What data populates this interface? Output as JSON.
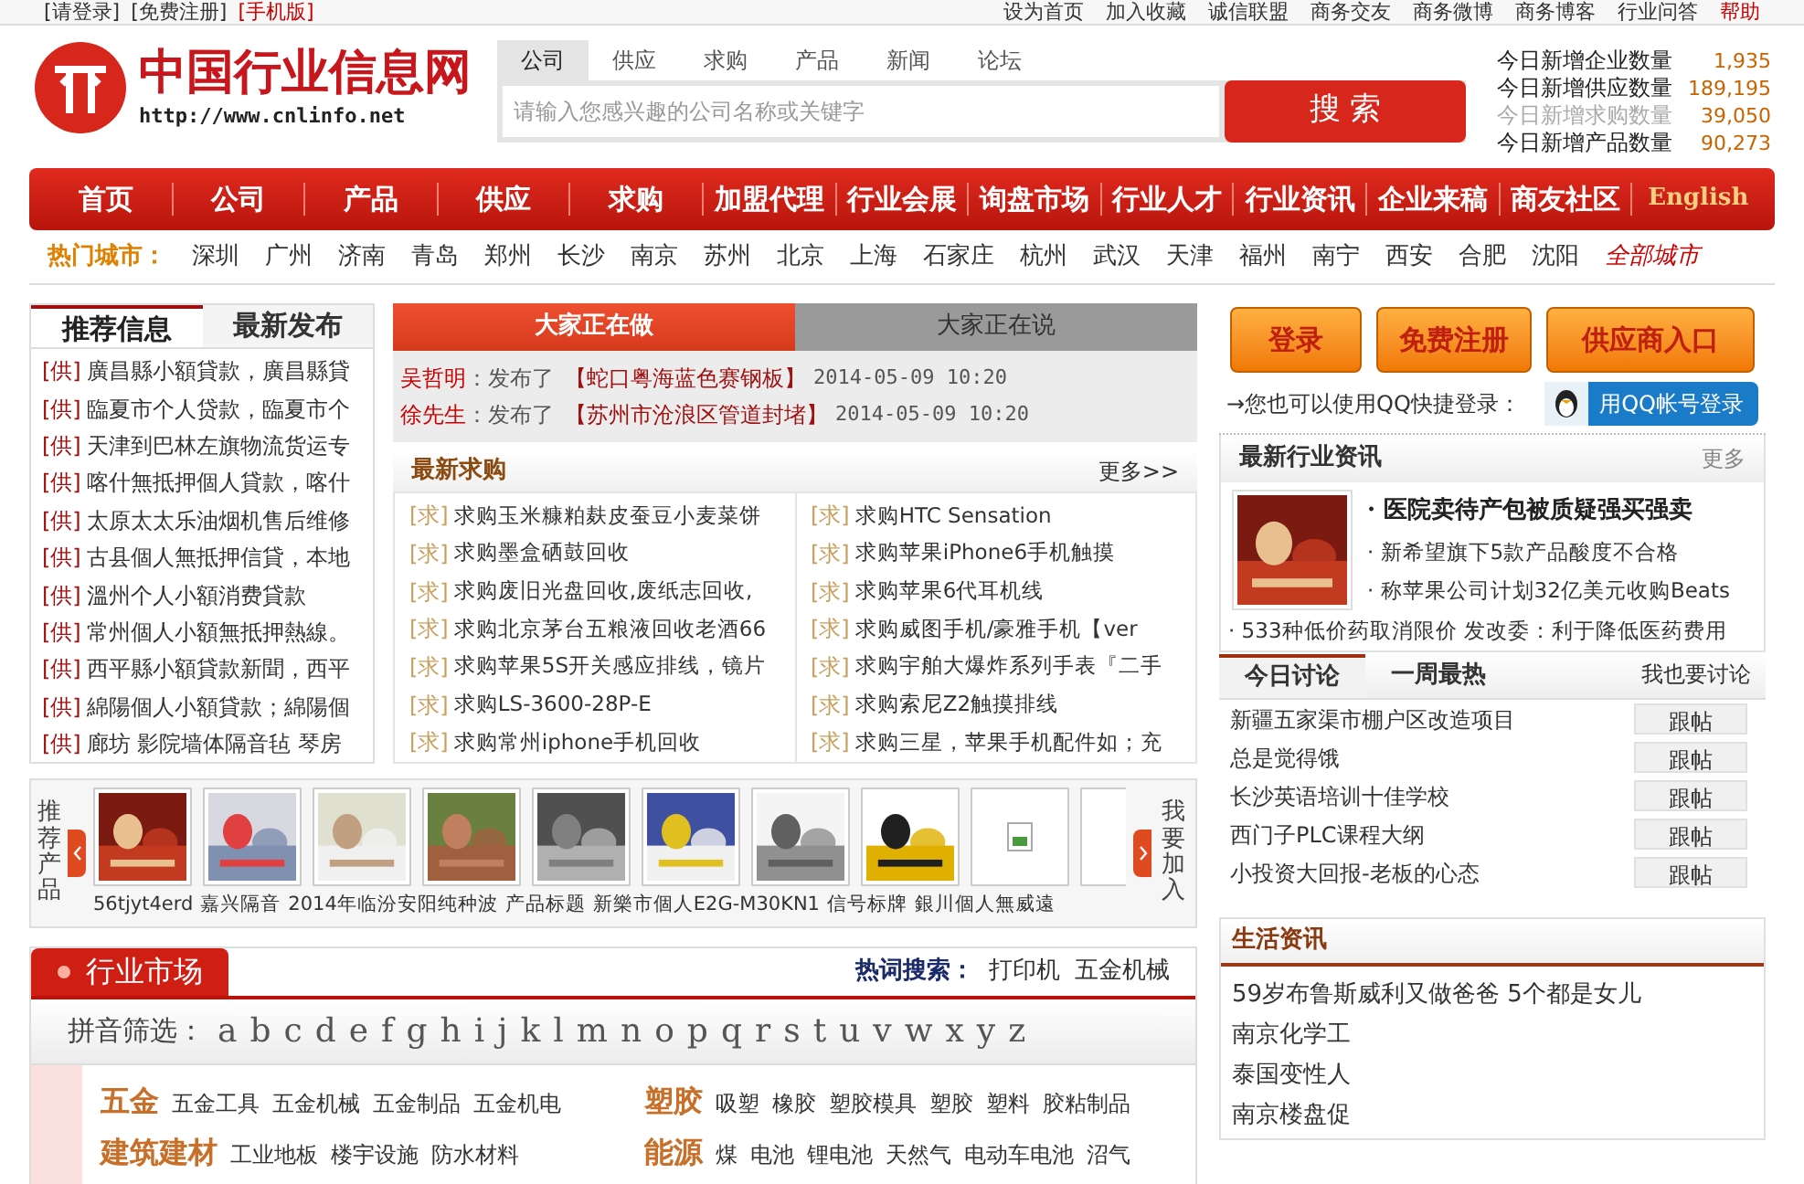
{
  "top_bar": {
    "left_links": [
      "[请登录]",
      "[免费注册]"
    ],
    "mobile_link": "[手机版]",
    "right_links": [
      {
        "text": "设为首页",
        "highlight": false
      },
      {
        "text": "加入收藏",
        "highlight": false
      },
      {
        "text": "诚信联盟",
        "highlight": false
      },
      {
        "text": "商务交友",
        "highlight": false
      },
      {
        "text": "商务微博",
        "highlight": false
      },
      {
        "text": "商务博客",
        "highlight": false
      },
      {
        "text": "行业问答",
        "highlight": false
      },
      {
        "text": "帮助",
        "highlight": true
      }
    ]
  },
  "header": {
    "logo": {
      "name": "中国行业信息网",
      "url": "http://www.cnlinfo.net"
    },
    "search": {
      "tabs": [
        {
          "label": "公司",
          "selected": true
        },
        {
          "label": "供应",
          "selected": false
        },
        {
          "label": "求购",
          "selected": false
        },
        {
          "label": "产品",
          "selected": false
        },
        {
          "label": "新闻",
          "selected": false
        },
        {
          "label": "论坛",
          "selected": false
        }
      ],
      "placeholder": "请输入您感兴趣的公司名称或关键字",
      "button": "搜 索"
    },
    "stats": [
      {
        "label": "今日新增企业数量",
        "value": "1,935",
        "dimmed": false
      },
      {
        "label": "今日新增供应数量",
        "value": "189,195",
        "dimmed": false
      },
      {
        "label": "今日新增求购数量",
        "value": "39,050",
        "dimmed": true
      },
      {
        "label": "今日新增产品数量",
        "value": "90,273",
        "dimmed": false
      }
    ]
  },
  "nav": [
    {
      "label": "首页",
      "kind": "cn"
    },
    {
      "label": "公司",
      "kind": "cn"
    },
    {
      "label": "产品",
      "kind": "cn"
    },
    {
      "label": "供应",
      "kind": "cn"
    },
    {
      "label": "求购",
      "kind": "cn"
    },
    {
      "label": "加盟代理",
      "kind": "cn"
    },
    {
      "label": "行业会展",
      "kind": "cn"
    },
    {
      "label": "询盘市场",
      "kind": "cn"
    },
    {
      "label": "行业人才",
      "kind": "cn"
    },
    {
      "label": "行业资讯",
      "kind": "cn"
    },
    {
      "label": "企业来稿",
      "kind": "cn"
    },
    {
      "label": "商友社区",
      "kind": "cn"
    },
    {
      "label": "English",
      "kind": "en"
    }
  ],
  "hot_cities": {
    "label": "热门城市：",
    "cities": [
      "深圳",
      "广州",
      "济南",
      "青岛",
      "郑州",
      "长沙",
      "南京",
      "苏州",
      "北京",
      "上海",
      "石家庄",
      "杭州",
      "武汉",
      "天津",
      "福州",
      "南宁",
      "西安",
      "合肥",
      "沈阳"
    ],
    "all": "全部城市"
  },
  "recommend": {
    "tabs": [
      {
        "label": "推荐信息",
        "selected": true
      },
      {
        "label": "最新发布",
        "selected": false
      }
    ],
    "items": [
      {
        "tag": "[供]",
        "text": "廣昌縣小額貸款，廣昌縣貸"
      },
      {
        "tag": "[供]",
        "text": "臨夏市个人贷款，臨夏市个"
      },
      {
        "tag": "[供]",
        "text": "天津到巴林左旗物流货运专"
      },
      {
        "tag": "[供]",
        "text": "喀什無抵押個人貸款，喀什"
      },
      {
        "tag": "[供]",
        "text": "太原太太乐油烟机售后维修"
      },
      {
        "tag": "[供]",
        "text": "古县個人無抵押信貸，本地"
      },
      {
        "tag": "[供]",
        "text": "溫州个人小額消费貸款"
      },
      {
        "tag": "[供]",
        "text": "常州個人小額無抵押熱線。"
      },
      {
        "tag": "[供]",
        "text": "西平縣小額貸款新聞，西平"
      },
      {
        "tag": "[供]",
        "text": "綿陽個人小額貸款；綿陽個"
      },
      {
        "tag": "[供]",
        "text": "廊坊 影院墙体隔音毡 琴房"
      }
    ]
  },
  "activity": {
    "tabs": [
      {
        "label": "大家正在做",
        "selected": true
      },
      {
        "label": "大家正在说",
        "selected": false
      }
    ],
    "entries": [
      {
        "user": "吴哲明",
        "action": "：发布了",
        "title": "【蛇口粤海蓝色赛钢板】",
        "time": "2014-05-09 10:20"
      },
      {
        "user": "徐先生",
        "action": "：发布了",
        "title": "【苏州市沧浪区管道封堵】",
        "time": "2014-05-09 10:20"
      }
    ]
  },
  "latest_buy": {
    "title": "最新求购",
    "more": "更多>>",
    "left": [
      {
        "tag": "[求]",
        "text": "求购玉米糠粕麸皮蚕豆小麦菜饼"
      },
      {
        "tag": "[求]",
        "text": "求购墨盒硒鼓回收"
      },
      {
        "tag": "[求]",
        "text": "求购废旧光盘回收,废纸志回收,"
      },
      {
        "tag": "[求]",
        "text": "求购北京茅台五粮液回收老酒66"
      },
      {
        "tag": "[求]",
        "text": "求购苹果5S开关感应排线，镜片"
      },
      {
        "tag": "[求]",
        "text": "求购LS-3600-28P-E"
      },
      {
        "tag": "[求]",
        "text": "求购常州iphone手机回收"
      }
    ],
    "right": [
      {
        "tag": "[求]",
        "text": "求购HTC Sensation"
      },
      {
        "tag": "[求]",
        "text": "求购苹果iPhone6手机触摸"
      },
      {
        "tag": "[求]",
        "text": "求购苹果6代耳机线"
      },
      {
        "tag": "[求]",
        "text": "求购威图手机/豪雅手机【ver"
      },
      {
        "tag": "[求]",
        "text": "求购宇舶大爆炸系列手表『二手"
      },
      {
        "tag": "[求]",
        "text": "求购索尼Z2触摸排线"
      },
      {
        "tag": "[求]",
        "text": "求购三星，苹果手机配件如；充"
      }
    ]
  },
  "auth": {
    "buttons": [
      "登录",
      "免费注册",
      "供应商入口"
    ],
    "qq_prompt": "→您也可以使用QQ快捷登录：",
    "qq_button": "用QQ帐号登录"
  },
  "industry_news": {
    "title": "最新行业资讯",
    "more": "更多",
    "headline": "· 医院卖待产包被质疑强买强卖",
    "items": [
      "· 新希望旗下5款产品酸度不合格",
      "· 称苹果公司计划32亿美元收购Beats"
    ],
    "wide_item": "· 533种低价药取消限价 发改委：利于降低医药费用"
  },
  "discussion": {
    "tabs": [
      {
        "label": "今日讨论",
        "selected": true
      },
      {
        "label": "一周最热",
        "selected": false
      }
    ],
    "action": "我也要讨论",
    "topics": [
      {
        "title": "新疆五家渠市棚户区改造项目",
        "button": "跟帖"
      },
      {
        "title": "总是觉得饿",
        "button": "跟帖"
      },
      {
        "title": "长沙英语培训十佳学校",
        "button": "跟帖"
      },
      {
        "title": "西门子PLC课程大纲",
        "button": "跟帖"
      },
      {
        "title": "小投资大回报-老板的心态",
        "button": "跟帖"
      }
    ]
  },
  "products": {
    "label": "推荐产品",
    "join": "我要加入",
    "thumbs": [
      {
        "kind": "picture"
      },
      {
        "kind": "picture"
      },
      {
        "kind": "picture"
      },
      {
        "kind": "picture"
      },
      {
        "kind": "picture"
      },
      {
        "kind": "picture"
      },
      {
        "kind": "picture"
      },
      {
        "kind": "picture"
      },
      {
        "kind": "broken"
      },
      {
        "kind": "blank"
      }
    ],
    "captions": [
      "56tjyt4erd",
      "嘉兴隔音",
      "2014年临汾安阳纯种波",
      "产品标题",
      "新樂市個人E2G-M30KN1",
      "信号标牌",
      "銀川個人無威遠"
    ]
  },
  "market": {
    "title": "行业市场",
    "hot_label": "热词搜索：",
    "hot_words": [
      "打印机",
      "五金机械"
    ],
    "pinyin_label": "拼音筛选：",
    "letters": [
      "a",
      "b",
      "c",
      "d",
      "e",
      "f",
      "g",
      "h",
      "i",
      "j",
      "k",
      "l",
      "m",
      "n",
      "o",
      "p",
      "q",
      "r",
      "s",
      "t",
      "u",
      "v",
      "w",
      "x",
      "y",
      "z"
    ],
    "categories": [
      {
        "name": "五金",
        "items": [
          "五金工具",
          "五金机械",
          "五金制品",
          "五金机电"
        ]
      },
      {
        "name": "塑胶",
        "items": [
          "吸塑",
          "橡胶",
          "塑胶模具",
          "塑胶",
          "塑料",
          "胶粘制品"
        ]
      },
      {
        "name": "建筑建材",
        "items": [
          "工业地板",
          "楼宇设施",
          "防水材料"
        ]
      },
      {
        "name": "能源",
        "items": [
          "煤",
          "电池",
          "锂电池",
          "天然气",
          "电动车电池",
          "沼气"
        ]
      }
    ]
  },
  "life_news": {
    "title": "生活资讯",
    "items": [
      "59岁布鲁斯威利又做爸爸 5个都是女儿",
      "南京化学工",
      "泰国变性人",
      "南京楼盘促"
    ]
  }
}
